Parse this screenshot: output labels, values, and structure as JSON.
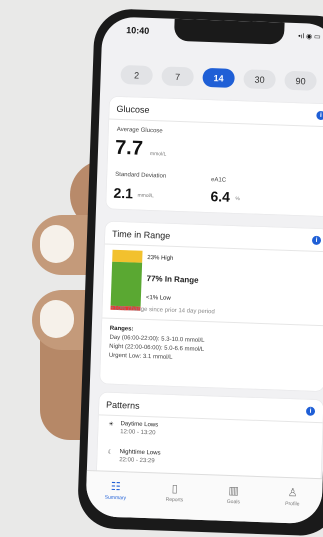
{
  "status": {
    "time": "10:40",
    "icons": "•ıl ◉ ▭"
  },
  "ranges": [
    "2",
    "7",
    "14",
    "30",
    "90"
  ],
  "glucose": {
    "title": "Glucose",
    "avg_label": "Average Glucose",
    "avg_value": "7.7",
    "avg_unit": "mmol/L",
    "sd_label": "Standard Deviation",
    "sd_value": "2.1",
    "sd_unit": "mmol/L",
    "a1c_label": "eA1C",
    "a1c_value": "6.4",
    "a1c_unit": "%"
  },
  "tir": {
    "title": "Time in Range",
    "high_label": "23% High",
    "in_label": "77% In Range",
    "low_label": "<1% Low",
    "change_note": "+10% change since prior 14 day period",
    "ranges_title": "Ranges:",
    "range_day": "Day (06:00-22:00): 5.3-10.0 mmol/L",
    "range_night": "Night (22:00-06:00): 5.0-6.6 mmol/L",
    "range_urgent": "Urgent Low: 3.1 mmol/L",
    "high_pct": 23,
    "in_pct": 77,
    "low_pct": 1,
    "colors": {
      "high": "#f2c12e",
      "in": "#5aa832",
      "low": "#e53935"
    }
  },
  "patterns": {
    "title": "Patterns",
    "items": [
      {
        "icon": "sun-icon",
        "name": "Daytime Lows",
        "time": "12:00 - 13:20"
      },
      {
        "icon": "moon-icon",
        "name": "Nighttime Lows",
        "time": "22:00 - 23:29"
      }
    ]
  },
  "tabs": [
    {
      "label": "Summary",
      "icon": "chart-icon"
    },
    {
      "label": "Reports",
      "icon": "document-icon"
    },
    {
      "label": "Goals",
      "icon": "bars-icon"
    },
    {
      "label": "Profile",
      "icon": "person-icon"
    }
  ]
}
